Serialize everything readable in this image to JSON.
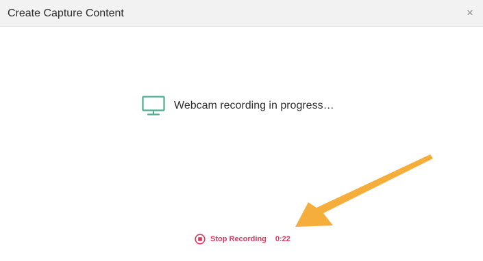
{
  "dialog": {
    "title": "Create Capture Content",
    "close_icon": "×"
  },
  "status": {
    "icon": "monitor-icon",
    "text": "Webcam recording in progress…"
  },
  "controls": {
    "stop_label": "Stop Recording",
    "timer": "0:22"
  },
  "colors": {
    "accent_green": "#4cae8c",
    "stop_red": "#d8395d",
    "annotation_arrow": "#f5ae3c"
  }
}
